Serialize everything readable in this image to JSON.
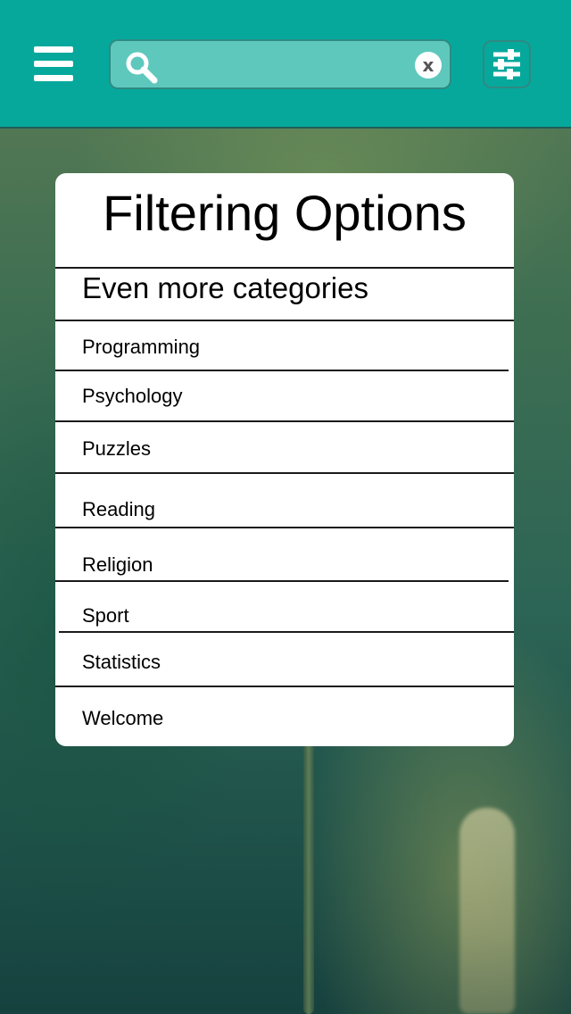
{
  "search": {
    "value": "",
    "placeholder": "",
    "clear_symbol": "x"
  },
  "panel": {
    "title": "Filtering Options",
    "section_header": "Even more categories",
    "categories": [
      "Programming",
      "Psychology",
      "Puzzles",
      "Reading",
      "Religion",
      "Sport",
      "Statistics",
      "Welcome"
    ]
  },
  "icons": {
    "menu": "menu-icon",
    "search": "search-icon",
    "clear": "clear-icon",
    "filter": "sliders-icon"
  },
  "colors": {
    "top_bar": "#06a89c",
    "search_field": "#5ec8bd",
    "panel": "#ffffff",
    "text": "#000000"
  }
}
